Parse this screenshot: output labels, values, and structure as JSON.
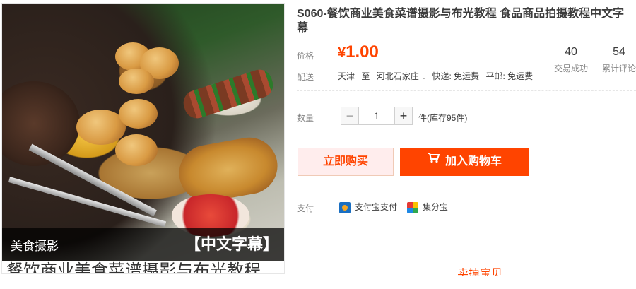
{
  "product": {
    "title": "S060-餐饮商业美食菜谱摄影与布光教程 食品商品拍摄教程中文字幕",
    "image_caption_left": "美食摄影",
    "image_caption_right": "【中文字幕】",
    "image_caption_bottom": "餐饮商业美食菜谱摄影与布光教程"
  },
  "price": {
    "label": "价格",
    "currency": "¥",
    "amount": "1.00"
  },
  "stats": {
    "transactions_value": "40",
    "transactions_label": "交易成功",
    "reviews_value": "54",
    "reviews_label": "累计评论"
  },
  "shipping": {
    "label": "配送",
    "from": "天津",
    "to_word": "至",
    "destination": "河北石家庄",
    "express": "快递: 免运费",
    "mail": "平邮: 免运费"
  },
  "quantity": {
    "label": "数量",
    "value": "1",
    "minus": "−",
    "plus": "+",
    "stock": "件(库存95件)"
  },
  "actions": {
    "buy_now": "立即购买",
    "add_to_cart": "加入购物车"
  },
  "payment": {
    "label": "支付",
    "alipay": "支付宝支付",
    "jifen": "集分宝"
  },
  "footer": {
    "partial_text": "卖掉宝贝"
  },
  "colors": {
    "accent": "#ff4400",
    "buy_now_bg": "#ffeded"
  }
}
